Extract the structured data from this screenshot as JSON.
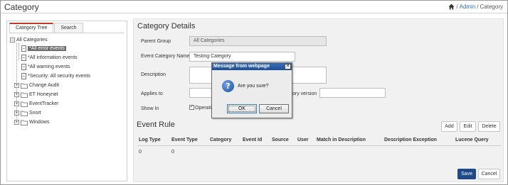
{
  "header": {
    "title": "Category",
    "breadcrumb": {
      "sep1": "/",
      "admin": "Admin",
      "sep2": "/",
      "current": "Category"
    }
  },
  "left_panel": {
    "tabs": [
      "Category Tree",
      "Search"
    ],
    "tree": {
      "root": "All Categories",
      "children": [
        "*All error events",
        "*All information events",
        "*All warning events",
        "*Security: All security events",
        "Change Audit",
        "ET Honeynet",
        "EventTracker",
        "Snort",
        "Windows"
      ]
    }
  },
  "details": {
    "title": "Category Details",
    "parent_group_label": "Parent Group",
    "parent_group_value": "All Categories",
    "event_category_name_label": "Event Category Name",
    "event_category_name_value": "Testing Category",
    "description_label": "Description",
    "applies_to_label": "Applies to",
    "category_version_label_partial": "ory version",
    "show_in_label": "Show In",
    "show_in_option_partial": "Operati"
  },
  "event_rule": {
    "title": "Event Rule",
    "buttons": {
      "add": "Add",
      "edit": "Edit",
      "delete": "Delete"
    },
    "columns": [
      "Log Type",
      "Event Type",
      "Category",
      "Event Id",
      "Source",
      "User",
      "Match in Description",
      "Description Exception",
      "Lucene Query"
    ],
    "rows": [
      [
        "0",
        "0"
      ]
    ]
  },
  "footer_buttons": {
    "save": "Save",
    "cancel": "Cancel"
  },
  "dialog": {
    "title": "Message from webpage",
    "message": "Are you sure?",
    "ok": "OK",
    "cancel": "Cancel",
    "close": "✕"
  },
  "colors": {
    "primary": "#1f4a8a",
    "dialog_title": "#2a5ea8",
    "tab_accent": "#c0392b"
  }
}
